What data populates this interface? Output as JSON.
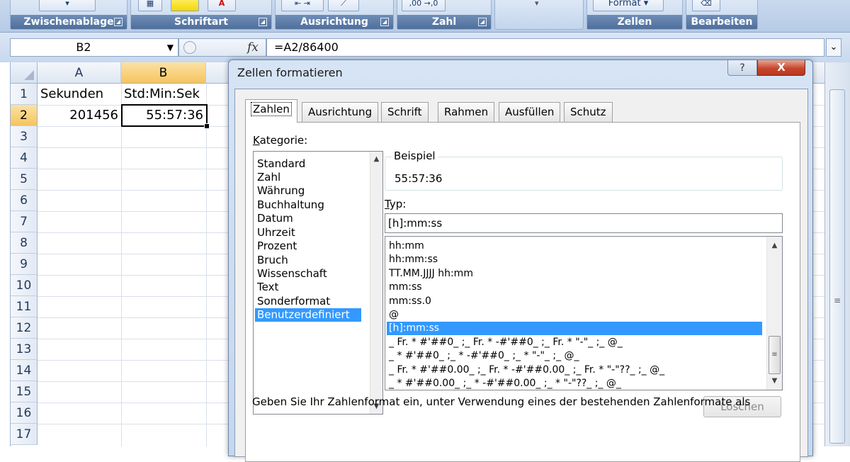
{
  "ribbon": {
    "groups": [
      "Zwischenablage",
      "Schriftart",
      "Ausrichtung",
      "Zahl",
      "Zellen",
      "Bearbeiten"
    ],
    "zahl_format_buttons": [
      ",00",
      "→,0"
    ],
    "zellen_format_button": "Format"
  },
  "formula_bar": {
    "name_box": "B2",
    "fx": "fx",
    "formula": "=A2/86400"
  },
  "sheet": {
    "columns": [
      "A",
      "B"
    ],
    "rows": [
      "1",
      "2",
      "3",
      "4",
      "5",
      "6",
      "7",
      "8",
      "9",
      "10",
      "11",
      "12",
      "13",
      "14",
      "15",
      "16",
      "17"
    ],
    "cells": {
      "A1": "Sekunden",
      "B1": "Std:Min:Sek",
      "A2": "201456",
      "B2": "55:57:36"
    }
  },
  "dialog": {
    "title": "Zellen formatieren",
    "help": "?",
    "close": "X",
    "tabs": [
      "Zahlen",
      "Ausrichtung",
      "Schrift",
      "Rahmen",
      "Ausfüllen",
      "Schutz"
    ],
    "category_label_ul": "K",
    "category_label_rest": "ategorie:",
    "categories": [
      "Standard",
      "Zahl",
      "Währung",
      "Buchhaltung",
      "Datum",
      "Uhrzeit",
      "Prozent",
      "Bruch",
      "Wissenschaft",
      "Text",
      "Sonderformat",
      "Benutzerdefiniert"
    ],
    "selected_category": "Benutzerdefiniert",
    "sample_label": "Beispiel",
    "sample_value": "55:57:36",
    "type_label_ul": "T",
    "type_label_rest": "yp:",
    "type_value": "[h]:mm:ss",
    "formats": [
      "hh:mm",
      "hh:mm:ss",
      "TT.MM.JJJJ hh:mm",
      "mm:ss",
      "mm:ss.0",
      "@",
      "[h]:mm:ss",
      "_ Fr. * #'##0_ ;_ Fr. * -#'##0_ ;_ Fr. * \"-\"_ ;_ @_",
      "_ * #'##0_ ;_ * -#'##0_ ;_ * \"-\"_ ;_ @_",
      "_ Fr. * #'##0.00_ ;_ Fr. * -#'##0.00_ ;_ Fr. * \"-\"??_ ;_ @_",
      "_ * #'##0.00_ ;_ * -#'##0.00_ ;_ * \"-\"??_ ;_ @_"
    ],
    "selected_format": "[h]:mm:ss",
    "delete_button": "Löschen",
    "hint": "Geben Sie Ihr Zahlenformat ein, unter Verwendung eines der bestehenden Zahlenformate als"
  }
}
